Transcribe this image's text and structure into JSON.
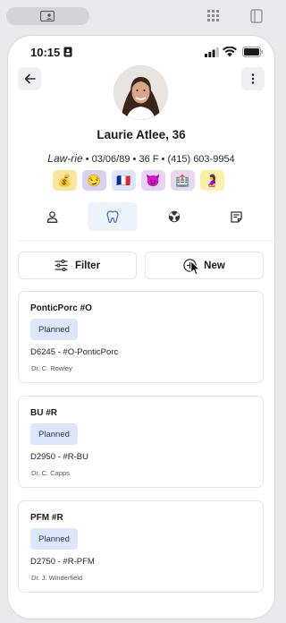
{
  "status_bar": {
    "time": "10:15"
  },
  "patient": {
    "name": "Laurie Atlee, 36",
    "alias": "Law-rie",
    "dob": "03/06/89",
    "age_sex": "36 F",
    "phone": "(415) 603-9954",
    "separator": "•",
    "badges": [
      {
        "name": "money-bag-badge",
        "glyph": "💰",
        "bg": "#f6e6a0"
      },
      {
        "name": "smirk-face-badge",
        "glyph": "😏",
        "bg": "#d9d0f3"
      },
      {
        "name": "france-flag-badge",
        "glyph": "🇫🇷",
        "bg": "#dbe6fb"
      },
      {
        "name": "devil-face-badge",
        "glyph": "😈",
        "bg": "#e8d3f5"
      },
      {
        "name": "hospital-badge",
        "glyph": "🏥",
        "bg": "#ead7ee"
      },
      {
        "name": "pregnant-badge",
        "glyph": "🤰",
        "bg": "#fbf0a8"
      }
    ]
  },
  "tabs": [
    {
      "name": "tab-profile",
      "icon": "person-icon",
      "active": false
    },
    {
      "name": "tab-dental",
      "icon": "tooth-icon",
      "active": true
    },
    {
      "name": "tab-radiology",
      "icon": "radiation-icon",
      "active": false
    },
    {
      "name": "tab-notes",
      "icon": "notes-icon",
      "active": false
    }
  ],
  "actions": {
    "filter_label": "Filter",
    "new_label": "New"
  },
  "cards": [
    {
      "title": "PonticPorc #O",
      "status": "Planned",
      "code": "D6245 - #O-PonticPorc",
      "doctor": "Dr. C. Rowley"
    },
    {
      "title": "BU #R",
      "status": "Planned",
      "code": "D2950 - #R-BU",
      "doctor": "Dr. C. Capps"
    },
    {
      "title": "PFM #R",
      "status": "Planned",
      "code": "D2750 - #R-PFM",
      "doctor": "Dr. J. Winderfield"
    }
  ],
  "colors": {
    "accent": "#3b6fd8",
    "status_badge_bg": "#dde6fb"
  }
}
